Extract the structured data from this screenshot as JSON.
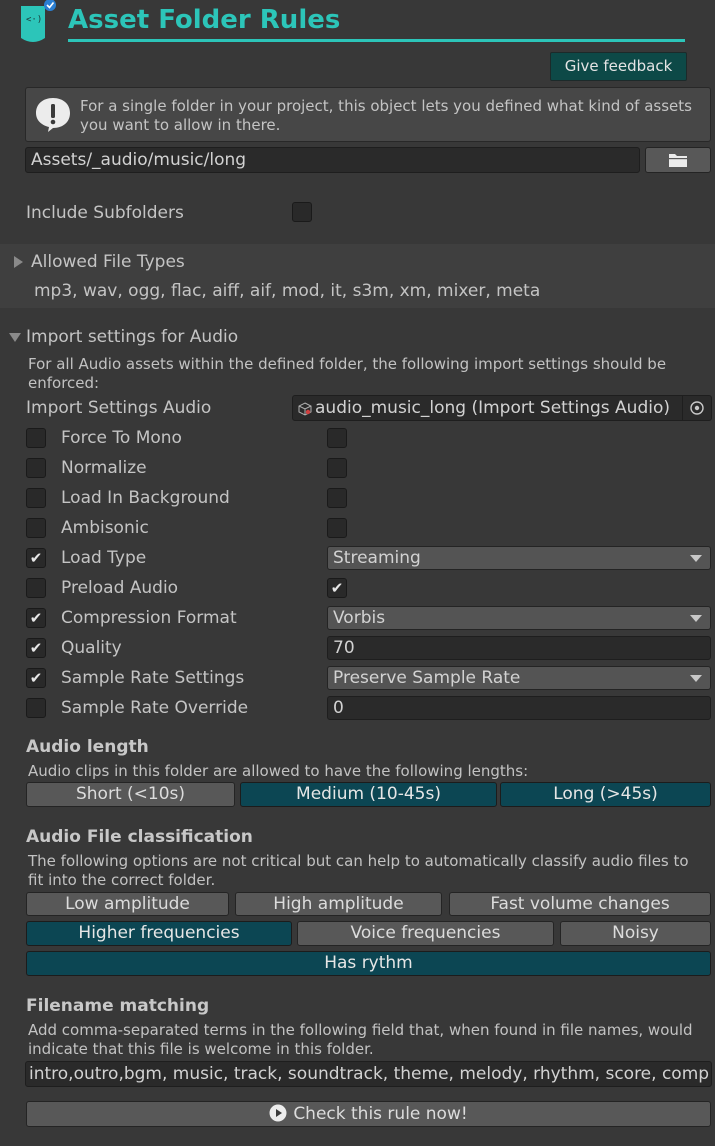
{
  "header": {
    "title": "Asset Folder Rules",
    "feedback_label": "Give feedback"
  },
  "info": {
    "text": "For a single folder in your project, this object lets you defined what kind of assets you want to allow in there."
  },
  "folder": {
    "path": "Assets/_audio/music/long"
  },
  "include_subfolders": {
    "label": "Include Subfolders",
    "checked": false
  },
  "allowed_types": {
    "label": "Allowed File Types",
    "value": "mp3, wav, ogg, flac, aiff, aif, mod, it, s3m, xm, mixer, meta"
  },
  "import_settings": {
    "label": "Import settings for Audio",
    "description": "For all Audio assets within the defined folder, the following import settings should be enforced:",
    "object_label": "Import Settings Audio",
    "object_value": "audio_music_long (Import Settings Audio)",
    "rows": [
      {
        "label": "Force To Mono",
        "enabled": false,
        "value_checked": false
      },
      {
        "label": "Normalize",
        "enabled": false,
        "value_checked": false
      },
      {
        "label": "Load In Background",
        "enabled": false,
        "value_checked": false
      },
      {
        "label": "Ambisonic",
        "enabled": false,
        "value_checked": false
      },
      {
        "label": "Load Type",
        "enabled": true,
        "value": "Streaming"
      },
      {
        "label": "Preload Audio",
        "enabled": false,
        "value_checked": true
      },
      {
        "label": "Compression Format",
        "enabled": true,
        "value": "Vorbis"
      },
      {
        "label": "Quality",
        "enabled": true,
        "value": "70"
      },
      {
        "label": "Sample Rate Settings",
        "enabled": true,
        "value": "Preserve Sample Rate"
      },
      {
        "label": "Sample Rate Override",
        "enabled": false,
        "value": "0"
      }
    ]
  },
  "audio_length": {
    "title": "Audio length",
    "description": "Audio clips in this folder are allowed to have the following lengths:",
    "options": [
      {
        "label": "Short (<10s)",
        "active": false
      },
      {
        "label": "Medium (10-45s)",
        "active": true
      },
      {
        "label": "Long (>45s)",
        "active": true
      }
    ]
  },
  "classification": {
    "title": "Audio File classification",
    "description": "The following options are not critical but can help to automatically classify audio files to fit into the correct folder.",
    "options": [
      {
        "label": "Low amplitude",
        "active": false
      },
      {
        "label": "High amplitude",
        "active": false
      },
      {
        "label": "Fast volume changes",
        "active": false
      },
      {
        "label": "Higher frequencies",
        "active": true
      },
      {
        "label": "Voice frequencies",
        "active": false
      },
      {
        "label": "Noisy",
        "active": false
      },
      {
        "label": "Has rythm",
        "active": true
      }
    ]
  },
  "filename": {
    "title": "Filename matching",
    "description": "Add comma-separated terms in the following field that, when found in file names, would indicate that this file is welcome in this folder.",
    "value": "intro,outro,bgm, music, track, soundtrack, theme, melody, rhythm, score, comp"
  },
  "check_button": {
    "label": "Check this rule now!"
  },
  "icons": {
    "logo": "rules-logo-icon",
    "info": "info-icon",
    "folder": "folder-icon",
    "object_picker": "object-picker-icon",
    "play": "play-icon",
    "foldout_closed": "triangle-right-icon",
    "foldout_open": "triangle-down-icon"
  },
  "colors": {
    "accent": "#2cc5b9",
    "active_toggle": "#0c4653",
    "feedback_button": "#0d4947"
  }
}
